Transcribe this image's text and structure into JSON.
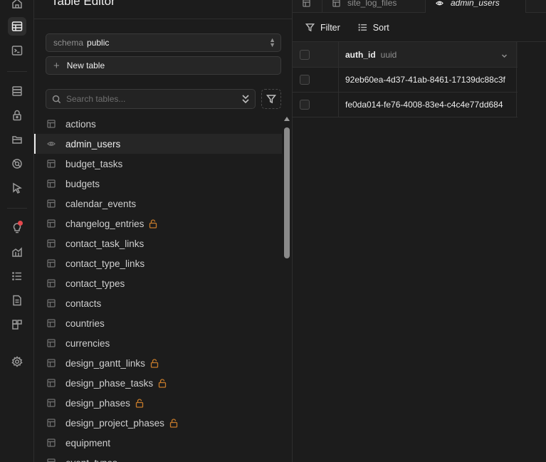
{
  "rail": {
    "icons": [
      "home-icon",
      "table-editor-icon",
      "sql-editor-icon",
      "database-icon",
      "auth-lock-icon",
      "storage-icon",
      "realtime-icon",
      "edge-functions-icon",
      "advisors-icon",
      "reports-icon",
      "logs-icon",
      "docs-icon",
      "integrations-icon",
      "settings-icon"
    ]
  },
  "sidebar": {
    "title": "Table Editor",
    "schema_label": "schema",
    "schema_value": "public",
    "new_table_label": "New table",
    "search_placeholder": "Search tables...",
    "tables": [
      {
        "name": "actions",
        "locked": false,
        "active": false
      },
      {
        "name": "admin_users",
        "locked": false,
        "active": true
      },
      {
        "name": "budget_tasks",
        "locked": false,
        "active": false
      },
      {
        "name": "budgets",
        "locked": false,
        "active": false
      },
      {
        "name": "calendar_events",
        "locked": false,
        "active": false
      },
      {
        "name": "changelog_entries",
        "locked": true,
        "active": false
      },
      {
        "name": "contact_task_links",
        "locked": false,
        "active": false
      },
      {
        "name": "contact_type_links",
        "locked": false,
        "active": false
      },
      {
        "name": "contact_types",
        "locked": false,
        "active": false
      },
      {
        "name": "contacts",
        "locked": false,
        "active": false
      },
      {
        "name": "countries",
        "locked": false,
        "active": false
      },
      {
        "name": "currencies",
        "locked": false,
        "active": false
      },
      {
        "name": "design_gantt_links",
        "locked": true,
        "active": false
      },
      {
        "name": "design_phase_tasks",
        "locked": true,
        "active": false
      },
      {
        "name": "design_phases",
        "locked": true,
        "active": false
      },
      {
        "name": "design_project_phases",
        "locked": true,
        "active": false
      },
      {
        "name": "equipment",
        "locked": false,
        "active": false
      },
      {
        "name": "event_types",
        "locked": false,
        "active": false
      }
    ]
  },
  "tabs": [
    {
      "label": "site_log_files",
      "active": false
    },
    {
      "label": "admin_users",
      "active": true
    }
  ],
  "toolbar": {
    "filter_label": "Filter",
    "sort_label": "Sort"
  },
  "grid": {
    "column_name": "auth_id",
    "column_type": "uuid",
    "rows": [
      "92eb60ea-4d37-41ab-8461-17139dc88c3f",
      "fe0da014-fe76-4008-83e4-c4c4e77dd684"
    ]
  },
  "colors": {
    "background": "#1c1c1c",
    "lock_accent": "#c57a2a",
    "notification": "#e5484d"
  }
}
